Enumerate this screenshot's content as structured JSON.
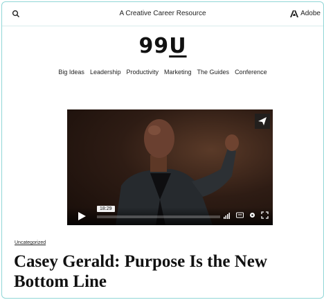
{
  "topbar": {
    "search_icon": "search-icon",
    "resource_text": "A Creative Career Resource",
    "adobe_label": "Adobe",
    "adobe_icon": "adobe-logo-icon"
  },
  "logo": {
    "text_main": "99",
    "text_u": "U"
  },
  "nav": {
    "items": [
      "Big Ideas",
      "Leadership",
      "Productivity",
      "Marketing",
      "The Guides",
      "Conference"
    ]
  },
  "video": {
    "timecode": "18:29",
    "share_icon": "paper-plane-icon",
    "play_icon": "play-icon",
    "control_icons": [
      "volume-icon",
      "captions-icon",
      "settings-gear-icon",
      "fullscreen-icon"
    ]
  },
  "article": {
    "category": "Uncategorized",
    "title_line1": "Casey Gerald: Purpose Is the New",
    "title_line2": "Bottom Line"
  },
  "colors": {
    "frame_border": "#8fd6d6",
    "text": "#111111"
  }
}
